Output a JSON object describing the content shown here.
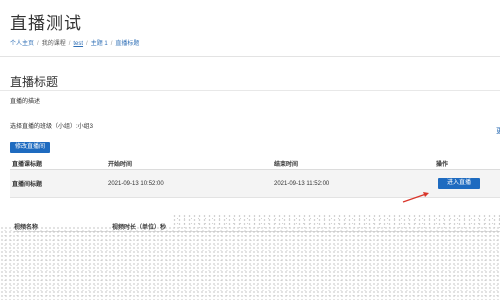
{
  "header": {
    "title": "直播测试",
    "breadcrumb": {
      "home": "个人主页",
      "courses": "我的课程",
      "course": "test",
      "topic": "主题 1",
      "current": "直播标题"
    }
  },
  "main": {
    "section_title": "直播标题",
    "description": "直播的描述",
    "group_label": "选择直播的班级（小组）:小组3",
    "edge_link_text": "更",
    "modify_button": "修改直播间",
    "live_table": {
      "columns": [
        "直播课标题",
        "开始时间",
        "结束时间",
        "操作"
      ],
      "rows": [
        {
          "title": "直播间标题",
          "start": "2021-09-13 10:52:00",
          "end": "2021-09-13 11:52:00",
          "action": "进入直播"
        }
      ]
    },
    "video_table": {
      "columns": [
        "视频名称",
        "视频时长（单位）秒"
      ]
    }
  },
  "colors": {
    "primary": "#1e6bc0",
    "link": "#2f6fb6",
    "annotation_arrow": "#d9362b"
  }
}
